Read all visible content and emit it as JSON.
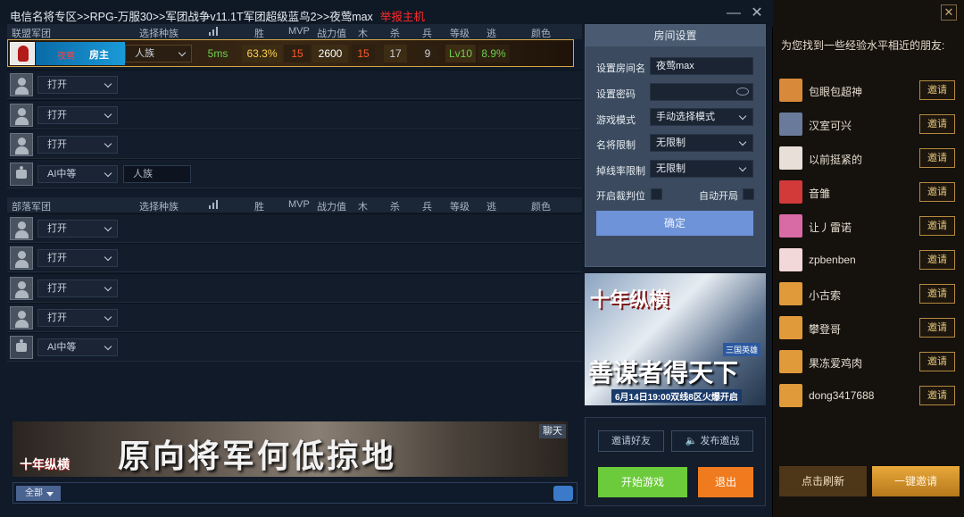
{
  "titlebar": {
    "path": "电信名将专区>>RPG-万服30>>军团战争v11.1T军团超级蓝鸟2>>夜莺max",
    "host_tag": "举报主机",
    "minimize": "—",
    "close": "✕"
  },
  "team_columns": [
    "选择种族",
    "胜",
    "MVP",
    "战力值",
    "木",
    "杀",
    "兵",
    "等级",
    "逃",
    "颜色"
  ],
  "team_a": {
    "name": "联盟军团",
    "host": {
      "name": "夜莺",
      "badge": "房主",
      "race": "人族",
      "ping": "5ms",
      "win_rate": "63.3%",
      "mvp": "15",
      "power": "2600",
      "wood": "15",
      "kills": "17",
      "soldiers": "9",
      "level": "Lv10",
      "escape": "8.9%"
    },
    "slots": [
      {
        "state": "打开"
      },
      {
        "state": "打开"
      },
      {
        "state": "打开"
      },
      {
        "state": "AI中等",
        "race": "人族"
      }
    ]
  },
  "team_b": {
    "name": "部落军团",
    "slots": [
      {
        "state": "打开"
      },
      {
        "state": "打开"
      },
      {
        "state": "打开"
      },
      {
        "state": "打开"
      },
      {
        "state": "AI中等"
      }
    ]
  },
  "settings": {
    "title": "房间设置",
    "room_name_label": "设置房间名",
    "room_name_value": "夜莺max",
    "password_label": "设置密码",
    "mode_label": "游戏模式",
    "mode_value": "手动选择模式",
    "general_limit_label": "名将限制",
    "general_limit_value": "无限制",
    "drop_limit_label": "掉线率限制",
    "drop_limit_value": "无限制",
    "judge_label": "开启裁判位",
    "autostart_label": "自动开局",
    "confirm": "确定"
  },
  "ad_right": {
    "brand": "十年纵横",
    "tag": "三国英雄",
    "slogan": "善谋者得天下",
    "date": "6月14日19:00双线8区火爆开启"
  },
  "chat": {
    "banner_slogan": "原向将军何低掠地",
    "banner_brand": "十年纵横",
    "tab": "聊天",
    "filter": "全部"
  },
  "actions": {
    "invite_friends": "邀请好友",
    "publish_invite": "发布邀战",
    "start": "开始游戏",
    "exit": "退出"
  },
  "friends": {
    "header": "为您找到一些经验水平相近的朋友:",
    "invite_label": "邀请",
    "list": [
      {
        "name": "包眼包超神",
        "color": "#d88a3a"
      },
      {
        "name": "汉室可兴",
        "color": "#6a7a9a"
      },
      {
        "name": "以前挺紧的",
        "color": "#e8e0d8"
      },
      {
        "name": "音雏",
        "color": "#d23a3a"
      },
      {
        "name": "让丿雷诺",
        "color": "#d86aa6"
      },
      {
        "name": "zpbenben",
        "color": "#f2d8d8"
      },
      {
        "name": "小古索",
        "color": "#e09a3a"
      },
      {
        "name": "攀登哥",
        "color": "#e09a3a"
      },
      {
        "name": "果冻爱鸡肉",
        "color": "#e09a3a"
      },
      {
        "name": "dong3417688",
        "color": "#e09a3a"
      }
    ],
    "refresh": "点击刷新",
    "one_click_invite": "一键邀请",
    "close": "✕"
  }
}
